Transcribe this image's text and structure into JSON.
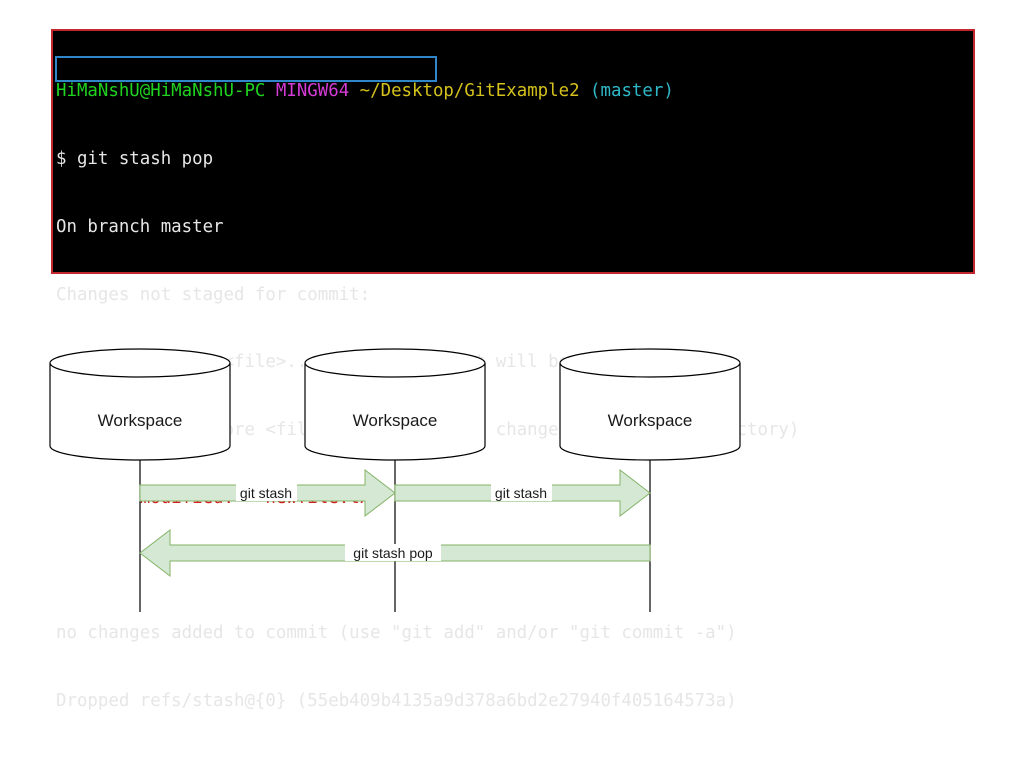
{
  "terminal": {
    "prompt": {
      "user_host": "HiMaNshU@HiMaNshU-PC",
      "system": "MINGW64",
      "path": "~/Desktop/GitExample2",
      "branch": "(master)"
    },
    "command": "$ git stash pop",
    "lines": [
      "On branch master",
      "Changes not staged for commit:",
      "  (use \"git add <file>...\" to update what will be committed)",
      "  (use \"git restore <file>...\" to discard changes in working directory)"
    ],
    "modified_label": "modified:",
    "modified_file": "newfile.txt",
    "footer_lines": [
      "no changes added to commit (use \"git add\" and/or \"git commit -a\")",
      "Dropped refs/stash@{0} (55eb409b4135a9d378a6bd2e27940f405164573a)"
    ],
    "colors": {
      "background": "#000000",
      "border": "#c1272d",
      "user_host": "#1fd31f",
      "system": "#d53bd5",
      "path": "#d4c11c",
      "branch": "#2fb8c8",
      "modified": "#d41f1f",
      "command_highlight": "#2f86c9"
    }
  },
  "diagram": {
    "nodes": [
      {
        "label": "Workspace"
      },
      {
        "label": "Workspace"
      },
      {
        "label": "Workspace"
      }
    ],
    "arrows": [
      {
        "label": "git stash",
        "from": 0,
        "to": 1
      },
      {
        "label": "git stash",
        "from": 1,
        "to": 2
      },
      {
        "label": "git stash pop",
        "from": 2,
        "to": 0
      }
    ],
    "colors": {
      "arrow_fill": "#d5e8d4",
      "arrow_stroke": "#82b366",
      "node_stroke": "#000000"
    }
  }
}
